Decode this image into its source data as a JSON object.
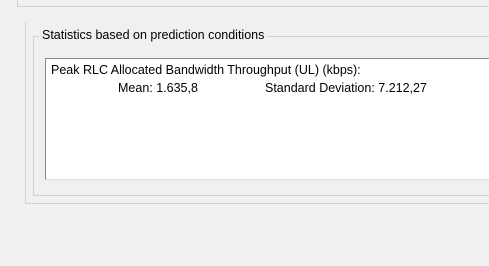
{
  "group": {
    "title": "Statistics based on prediction conditions"
  },
  "stats": {
    "metric_label": "Peak RLC Allocated Bandwidth Throughput (UL) (kbps):",
    "mean_text": "Mean: 1.635,8",
    "std_text": "Standard Deviation: 7.212,27"
  }
}
